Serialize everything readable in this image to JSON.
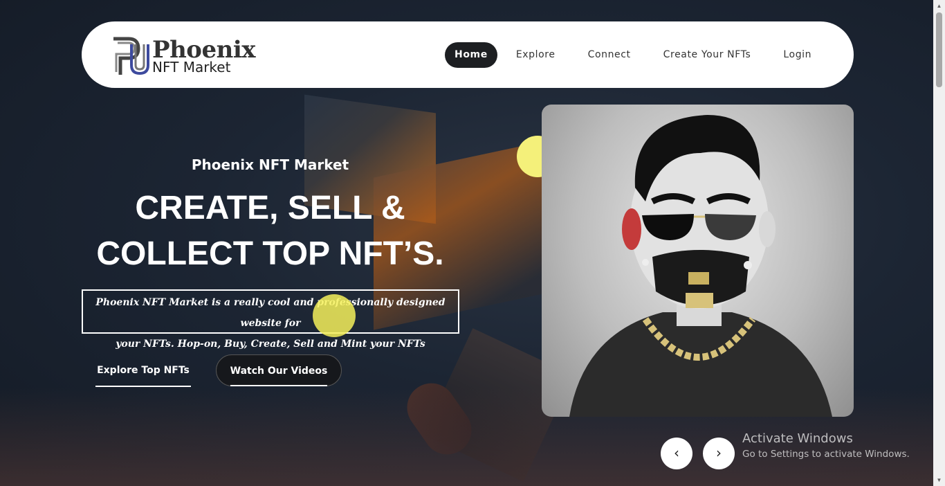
{
  "brand": {
    "title": "Phoenix",
    "subtitle": "NFT Market"
  },
  "nav": {
    "items": [
      {
        "label": "Home",
        "active": true
      },
      {
        "label": "Explore",
        "active": false
      },
      {
        "label": "Connect",
        "active": false
      },
      {
        "label": "Create Your NFTs",
        "active": false
      },
      {
        "label": "Login",
        "active": false
      }
    ]
  },
  "hero": {
    "eyebrow": "Phoenix NFT Market",
    "headline_line1": "CREATE, SELL &",
    "headline_line2": "COLLECT TOP NFT’S.",
    "description_line1": "Phoenix NFT Market is a really cool and professionally designed website for",
    "description_line2": "your NFTs. Hop-on, Buy, Create, Sell and Mint your NFTs",
    "primary_button": "Explore Top NFTs",
    "secondary_button": "Watch Our Videos"
  },
  "carousel": {
    "prev_label": "‹",
    "next_label": "›"
  },
  "watermark": {
    "title": "Activate Windows",
    "subtitle": "Go to Settings to activate Windows."
  },
  "scrollbar": {
    "up_label": "▲",
    "down_label": "▼"
  },
  "colors": {
    "background": "#1b2431",
    "nav_active_bg": "#1d1f22",
    "accent_orb": "#f4f07a"
  },
  "icons": [
    "logo-mark-icon",
    "chevron-left-icon",
    "chevron-right-icon"
  ]
}
